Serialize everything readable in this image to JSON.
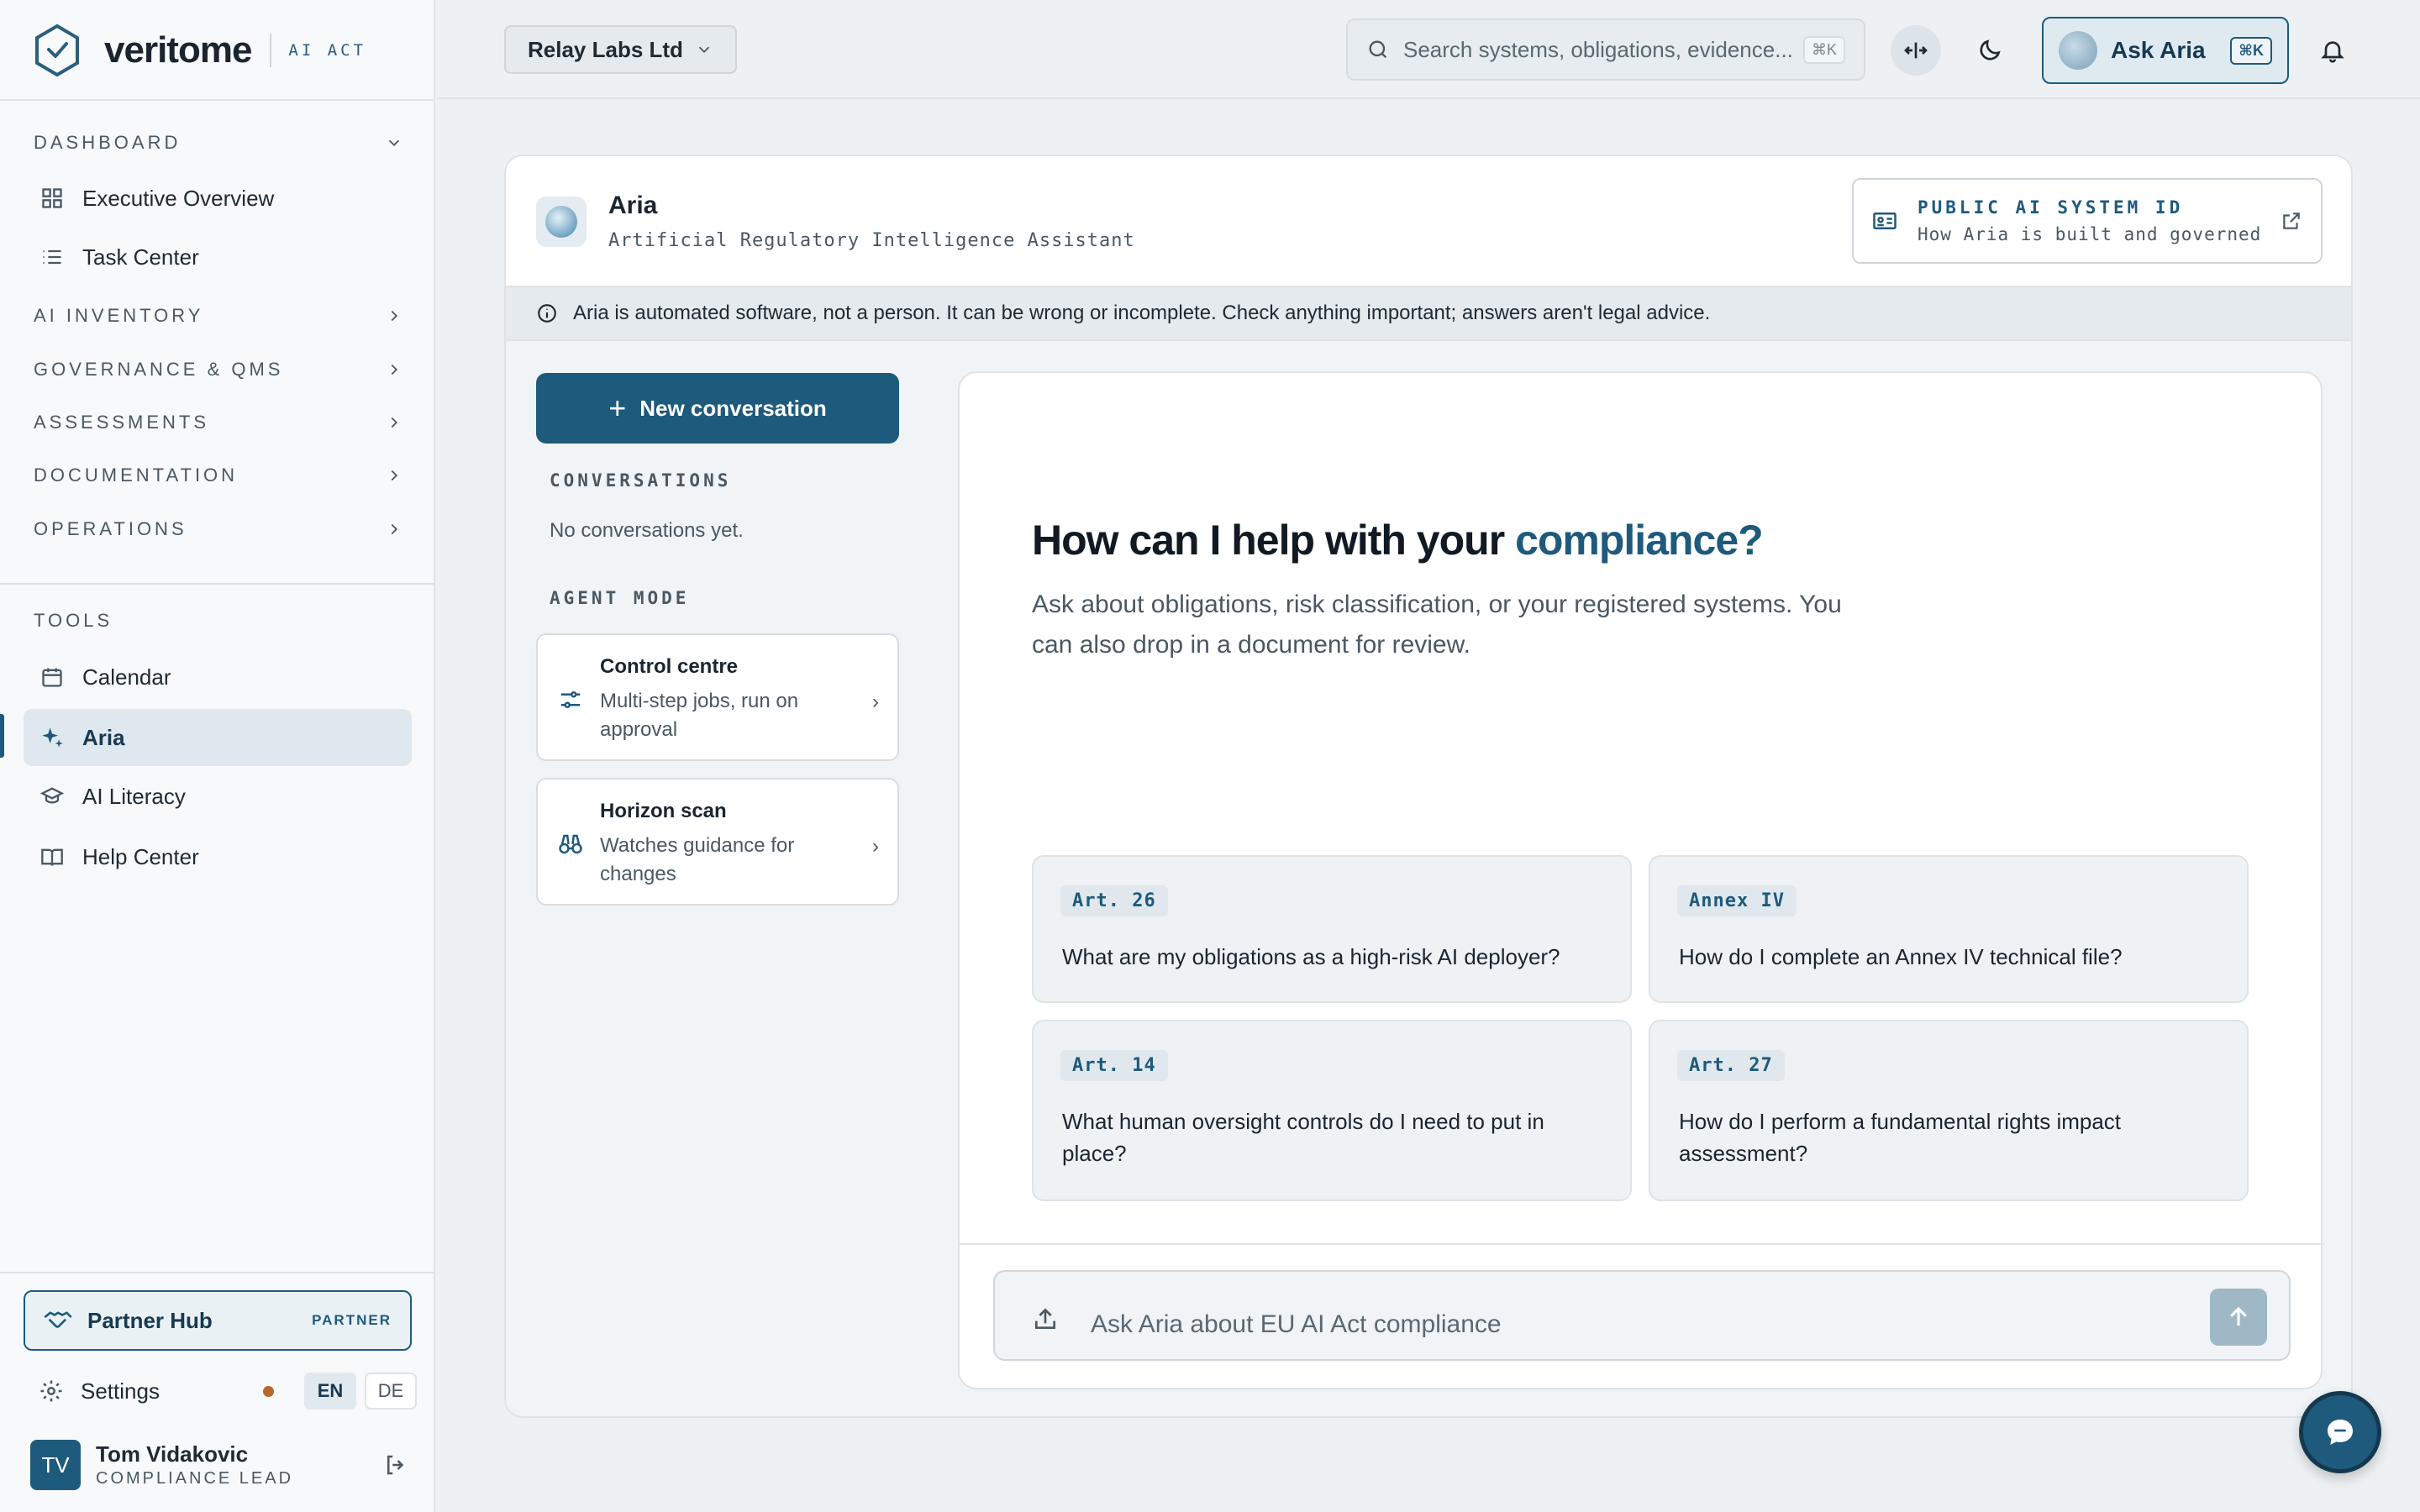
{
  "brand": {
    "name": "veritome",
    "tag": "AI ACT"
  },
  "sidebar": {
    "sections": [
      {
        "label": "DASHBOARD",
        "expanded": true
      },
      {
        "label": "AI INVENTORY",
        "expanded": false
      },
      {
        "label": "GOVERNANCE & QMS",
        "expanded": false
      },
      {
        "label": "ASSESSMENTS",
        "expanded": false
      },
      {
        "label": "DOCUMENTATION",
        "expanded": false
      },
      {
        "label": "OPERATIONS",
        "expanded": false
      }
    ],
    "dashboard_items": [
      {
        "label": "Executive Overview",
        "icon": "grid-icon"
      },
      {
        "label": "Task Center",
        "icon": "list-icon"
      }
    ],
    "tools_label": "TOOLS",
    "tools_items": [
      {
        "label": "Calendar",
        "icon": "calendar-icon"
      },
      {
        "label": "Aria",
        "icon": "sparkle-icon",
        "active": true
      },
      {
        "label": "AI Literacy",
        "icon": "graduation-cap-icon"
      },
      {
        "label": "Help Center",
        "icon": "book-icon"
      }
    ],
    "partner": {
      "label": "Partner Hub",
      "badge": "PARTNER"
    },
    "settings": {
      "label": "Settings",
      "lang_en": "EN",
      "lang_de": "DE",
      "active_lang": "EN"
    },
    "user": {
      "initials": "TV",
      "name": "Tom Vidakovic",
      "role": "COMPLIANCE LEAD"
    }
  },
  "topbar": {
    "org": "Relay Labs Ltd",
    "search_placeholder": "Search systems, obligations, evidence...",
    "search_shortcut": "⌘K",
    "ask_label": "Ask Aria",
    "ask_shortcut": "⌘K"
  },
  "header": {
    "title": "Aria",
    "subtitle": "Artificial Regulatory Intelligence Assistant",
    "public_id_title": "PUBLIC AI SYSTEM ID",
    "public_id_sub": "How Aria is built and governed"
  },
  "notice": "Aria is automated software, not a person. It can be wrong or incomplete. Check anything important; answers aren't legal advice.",
  "conversations": {
    "new_label": "New conversation",
    "heading": "CONVERSATIONS",
    "empty": "No conversations yet.",
    "agent_heading": "AGENT MODE",
    "agent_modes": [
      {
        "title": "Control centre",
        "desc": "Multi-step jobs, run on approval"
      },
      {
        "title": "Horizon scan",
        "desc": "Watches guidance for changes"
      }
    ]
  },
  "chat": {
    "headline_pre": "How can I help with your ",
    "headline_accent": "compliance?",
    "intro": "Ask about obligations, risk classification, or your registered systems. You can also drop in a document for review.",
    "suggestions": [
      {
        "tag": "Art. 26",
        "question": "What are my obligations as a high-risk AI deployer?"
      },
      {
        "tag": "Annex IV",
        "question": "How do I complete an Annex IV technical file?"
      },
      {
        "tag": "Art. 14",
        "question": "What human oversight controls do I need to put in place?"
      },
      {
        "tag": "Art. 27",
        "question": "How do I perform a fundamental rights impact assessment?"
      }
    ],
    "composer_placeholder": "Ask Aria about EU AI Act compliance"
  },
  "colors": {
    "accent": "#1e5a7c",
    "status_dot": "#b8672b"
  }
}
